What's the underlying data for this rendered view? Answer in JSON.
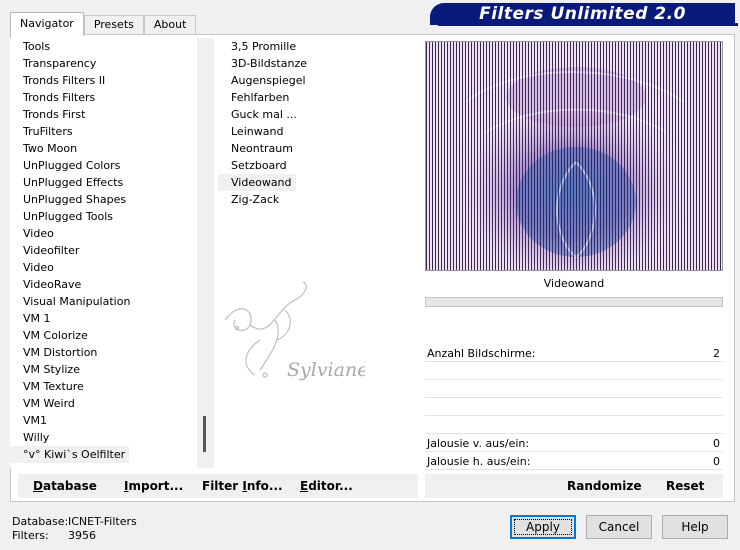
{
  "tabs": [
    {
      "label": "Navigator",
      "active": true
    },
    {
      "label": "Presets",
      "active": false
    },
    {
      "label": "About",
      "active": false
    }
  ],
  "banner": {
    "title": "Filters Unlimited 2.0",
    "color": "#0a1a7a"
  },
  "categories": [
    "Tools",
    "Transparency",
    "Tronds Filters II",
    "Tronds Filters",
    "Tronds First",
    "TruFilters",
    "Two Moon",
    "UnPlugged Colors",
    "UnPlugged Effects",
    "UnPlugged Shapes",
    "UnPlugged Tools",
    "Video",
    "Videofilter",
    "Video",
    "VideoRave",
    "Visual Manipulation",
    "VM 1",
    "VM Colorize",
    "VM Distortion",
    "VM Stylize",
    "VM Texture",
    "VM Weird",
    "VM1",
    "Willy",
    "°v° Kiwi`s Oelfilter"
  ],
  "selected_category": "°v° Kiwi`s Oelfilter",
  "filters": [
    "3,5 Promille",
    "3D-Bildstanze",
    "Augenspiegel",
    "Fehlfarben",
    "Guck mal ...",
    "Leinwand",
    "Neontraum",
    "Setzboard",
    "Videowand",
    "Zig-Zack"
  ],
  "selected_filter": "Videowand",
  "preview": {
    "filter_name": "Videowand"
  },
  "watermark": {
    "text": "Sylviane"
  },
  "params": [
    {
      "label": "Anzahl Bildschirme:",
      "value": "2"
    },
    {
      "label": "",
      "value": ""
    },
    {
      "label": "",
      "value": ""
    },
    {
      "label": "",
      "value": ""
    },
    {
      "label": "",
      "value": ""
    },
    {
      "label": "Jalousie v. aus/ein:",
      "value": "0"
    },
    {
      "label": "Jalousie h. aus/ein:",
      "value": "0"
    }
  ],
  "toolbar": {
    "database": {
      "ul": "D",
      "rest": "atabase"
    },
    "import": {
      "ul": "I",
      "rest": "mport..."
    },
    "filter_info": {
      "pre": "Filter ",
      "ul": "I",
      "rest": "nfo..."
    },
    "editor": {
      "ul": "E",
      "rest": "ditor..."
    },
    "randomize": "Randomize",
    "reset": "Reset"
  },
  "status": {
    "database_label": "Database:",
    "database_value": "ICNET-Filters",
    "filters_label": "Filters:",
    "filters_value": "3956"
  },
  "buttons": {
    "apply": "Apply",
    "cancel": "Cancel",
    "help": "Help"
  }
}
